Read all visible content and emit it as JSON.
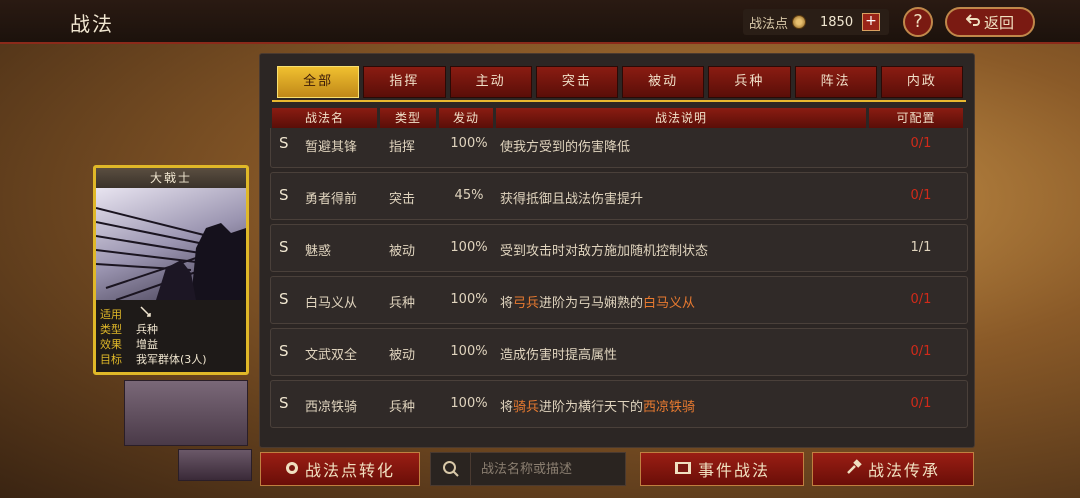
{
  "header": {
    "title": "战法",
    "points_label": "战法点",
    "points_value": "1850",
    "plus": "+",
    "help": "?",
    "back_label": "返回"
  },
  "tabs": [
    {
      "label": "全部",
      "active": true
    },
    {
      "label": "指挥",
      "active": false
    },
    {
      "label": "主动",
      "active": false
    },
    {
      "label": "突击",
      "active": false
    },
    {
      "label": "被动",
      "active": false
    },
    {
      "label": "兵种",
      "active": false
    },
    {
      "label": "阵法",
      "active": false
    },
    {
      "label": "内政",
      "active": false
    }
  ],
  "columns": {
    "name": "战法名",
    "type": "类型",
    "rate": "发动",
    "desc": "战法说明",
    "config": "可配置"
  },
  "rows": [
    {
      "grade": "S",
      "name": "暂避其锋",
      "type": "指挥",
      "rate": "100%",
      "desc": [
        {
          "t": "使我方受到的伤害降低",
          "hl": false
        }
      ],
      "config": "0/1",
      "zero": true
    },
    {
      "grade": "S",
      "name": "勇者得前",
      "type": "突击",
      "rate": "45%",
      "desc": [
        {
          "t": "获得抵御且战法伤害提升",
          "hl": false
        }
      ],
      "config": "0/1",
      "zero": true
    },
    {
      "grade": "S",
      "name": "魅惑",
      "type": "被动",
      "rate": "100%",
      "desc": [
        {
          "t": "受到攻击时对敌方施加随机控制状态",
          "hl": false
        }
      ],
      "config": "1/1",
      "zero": false
    },
    {
      "grade": "S",
      "name": "白马义从",
      "type": "兵种",
      "rate": "100%",
      "desc": [
        {
          "t": "将",
          "hl": false
        },
        {
          "t": "弓兵",
          "hl": true
        },
        {
          "t": "进阶为弓马娴熟的",
          "hl": false
        },
        {
          "t": "白马义从",
          "hl": true
        }
      ],
      "config": "0/1",
      "zero": true
    },
    {
      "grade": "S",
      "name": "文武双全",
      "type": "被动",
      "rate": "100%",
      "desc": [
        {
          "t": "造成伤害时提高属性",
          "hl": false
        }
      ],
      "config": "0/1",
      "zero": true
    },
    {
      "grade": "S",
      "name": "西凉铁骑",
      "type": "兵种",
      "rate": "100%",
      "desc": [
        {
          "t": "将",
          "hl": false
        },
        {
          "t": "骑兵",
          "hl": true
        },
        {
          "t": "进阶为横行天下的",
          "hl": false
        },
        {
          "t": "西凉铁骑",
          "hl": true
        }
      ],
      "config": "0/1",
      "zero": true
    }
  ],
  "card": {
    "title": "大戟士",
    "labels": {
      "apply": "适用",
      "type": "类型",
      "effect": "效果",
      "target": "目标"
    },
    "values": {
      "type": "兵种",
      "effect": "增益",
      "target": "我军群体(3人)"
    },
    "apply_icon": "spear-icon"
  },
  "bottom": {
    "convert_label": "战法点转化",
    "search_placeholder": "战法名称或描述",
    "event_label": "事件战法",
    "inherit_label": "战法传承"
  },
  "colors": {
    "accent_red": "#8a1c12",
    "active_gold": "#f0c030",
    "zero_red": "#d02a1a",
    "highlight_orange": "#e87a30"
  }
}
